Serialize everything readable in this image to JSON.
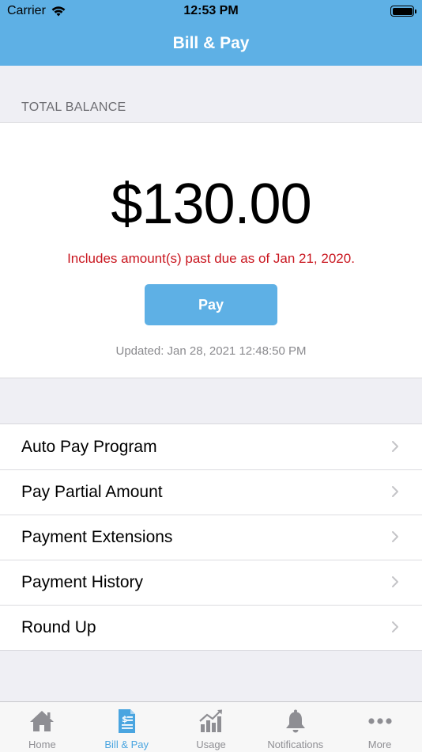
{
  "status_bar": {
    "carrier": "Carrier",
    "time": "12:53 PM"
  },
  "nav": {
    "title": "Bill & Pay"
  },
  "balance": {
    "section_label": "TOTAL BALANCE",
    "amount": "$130.00",
    "past_due_message": "Includes amount(s) past due as of Jan 21, 2020.",
    "pay_label": "Pay",
    "updated": "Updated: Jan 28, 2021 12:48:50 PM"
  },
  "menu": {
    "items": [
      {
        "label": "Auto Pay Program"
      },
      {
        "label": "Pay Partial Amount"
      },
      {
        "label": "Payment Extensions"
      },
      {
        "label": "Payment History"
      },
      {
        "label": "Round Up"
      }
    ]
  },
  "tabs": [
    {
      "label": "Home",
      "icon": "home-icon"
    },
    {
      "label": "Bill & Pay",
      "icon": "bill-icon",
      "active": true
    },
    {
      "label": "Usage",
      "icon": "usage-chart-icon"
    },
    {
      "label": "Notifications",
      "icon": "bell-icon"
    },
    {
      "label": "More",
      "icon": "more-icon"
    }
  ],
  "colors": {
    "accent": "#5eb0e5",
    "past_due": "#c9151e",
    "inactive_tab": "#8e8e93"
  }
}
